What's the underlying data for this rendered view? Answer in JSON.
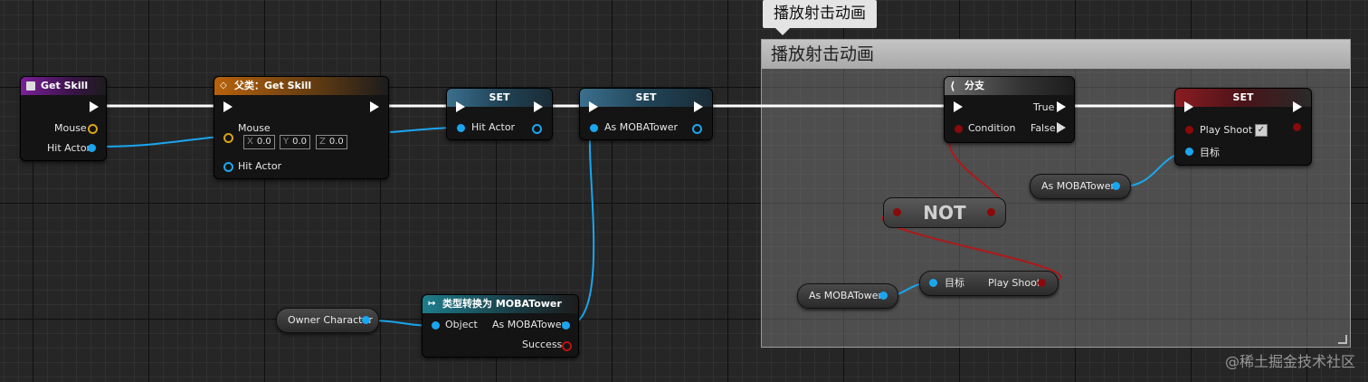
{
  "comment": {
    "title": "播放射击动画",
    "bubble": "播放射击动画"
  },
  "nodes": {
    "get_skill": {
      "title": "Get Skill",
      "pins": {
        "mouse": "Mouse",
        "hit_actor": "Hit Actor"
      }
    },
    "parent_get_skill": {
      "title": "父类：Get Skill",
      "pins": {
        "mouse": "Mouse",
        "hit_actor": "Hit Actor"
      },
      "vector": {
        "x_label": "X",
        "x": "0.0",
        "y_label": "Y",
        "y": "0.0",
        "z_label": "Z",
        "z": "0.0"
      }
    },
    "set_hit_actor": {
      "title": "SET",
      "pin": "Hit Actor"
    },
    "set_as_tower": {
      "title": "SET",
      "pin": "As MOBATower"
    },
    "branch": {
      "title": "分支",
      "pins": {
        "condition": "Condition",
        "true": "True",
        "false": "False"
      }
    },
    "set_play_shoot": {
      "title": "SET",
      "pins": {
        "play_shoot": "Play Shoot",
        "target": "目标"
      }
    },
    "not": {
      "title": "NOT"
    },
    "get_play_shoot": {
      "target": "目标",
      "play_shoot": "Play Shoot"
    },
    "cast": {
      "title": "类型转换为 MOBATower",
      "pins": {
        "object": "Object",
        "as_tower": "As MOBATower",
        "success": "Success"
      }
    }
  },
  "variables": {
    "owner_character": "Owner Character",
    "as_tower_1": "As MOBATower",
    "as_tower_2": "As MOBATower"
  },
  "watermark": "@稀土掘金技术社区",
  "colors": {
    "exec": "#ffffff",
    "object_pin": "#1aa6ef",
    "bool_pin": "#8a0a0a",
    "struct_pin": "#d9a21b"
  }
}
